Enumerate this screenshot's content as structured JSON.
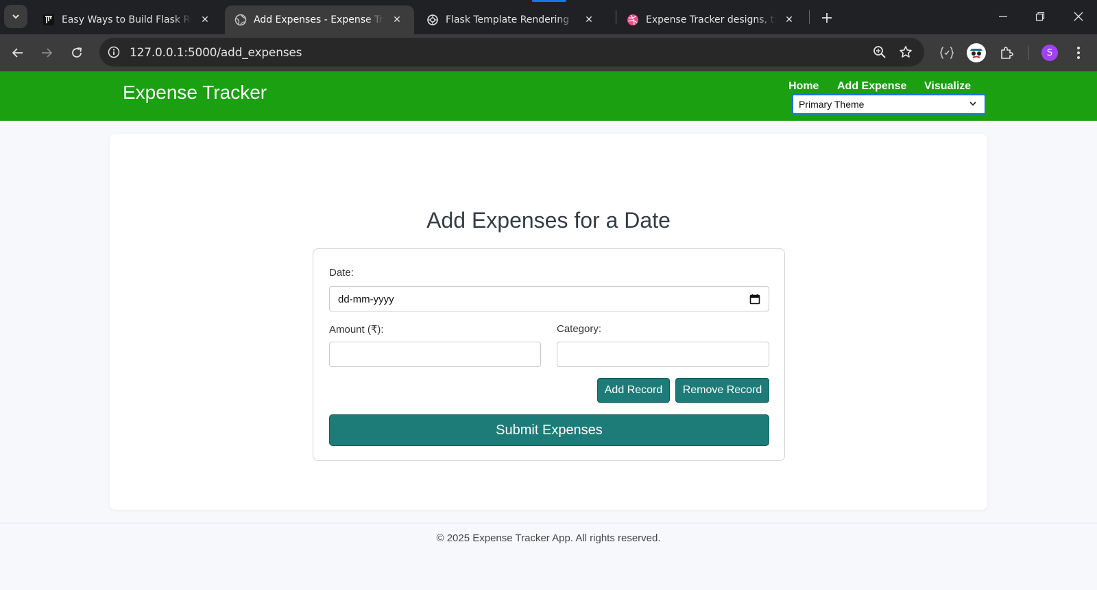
{
  "browser": {
    "tabs": [
      {
        "title": "Easy Ways to Build Flask Routes",
        "favicon": "tutorial-site-icon",
        "active": false
      },
      {
        "title": "Add Expenses - Expense Tracker",
        "favicon": "globe-icon",
        "active": true
      },
      {
        "title": "Flask Template Rendering",
        "favicon": "chatgpt-icon",
        "active": false
      },
      {
        "title": "Expense Tracker designs, themes",
        "favicon": "dribbble-icon",
        "active": false
      }
    ],
    "close_glyph": "✕",
    "url": "127.0.0.1:5000/add_expenses",
    "profile_initial": "S",
    "colors": {
      "tab_strip": "#202124",
      "toolbar": "#3c3c3c",
      "omnibox": "#282828",
      "profile": "#a142f4"
    }
  },
  "site": {
    "brand": "Expense Tracker",
    "nav": {
      "home": "Home",
      "add_expense": "Add Expense",
      "visualize": "Visualize"
    },
    "theme_select": {
      "value": "Primary Theme"
    },
    "colors": {
      "header": "#1aa011",
      "button": "#1d7b78",
      "background": "#f7f8fc"
    }
  },
  "form": {
    "heading": "Add Expenses for a Date",
    "date_label": "Date:",
    "date_value": "dd-mm-yyyy",
    "amount_label": "Amount (₹):",
    "amount_value": "",
    "category_label": "Category:",
    "category_value": "",
    "add_record": "Add Record",
    "remove_record": "Remove Record",
    "submit": "Submit Expenses"
  },
  "footer": {
    "text": "© 2025 Expense Tracker App. All rights reserved."
  }
}
